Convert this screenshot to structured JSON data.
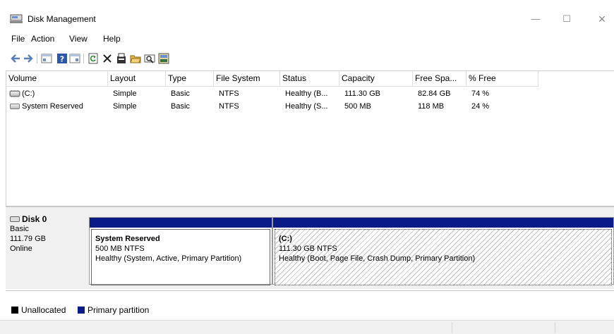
{
  "window": {
    "title": "Disk Management",
    "minimize": "—",
    "maximize": "☐",
    "close": "✕"
  },
  "menu": [
    "File",
    "Action",
    "View",
    "Help"
  ],
  "columns": [
    "Volume",
    "Layout",
    "Type",
    "File System",
    "Status",
    "Capacity",
    "Free Spa...",
    "% Free"
  ],
  "volumes": [
    {
      "volume": "(C:)",
      "layout": "Simple",
      "type": "Basic",
      "fs": "NTFS",
      "status": "Healthy (B...",
      "capacity": "111.30 GB",
      "free": "82.84 GB",
      "pct": "74 %"
    },
    {
      "volume": "System Reserved",
      "layout": "Simple",
      "type": "Basic",
      "fs": "NTFS",
      "status": "Healthy (S...",
      "capacity": "500 MB",
      "free": "118 MB",
      "pct": "24 %"
    }
  ],
  "disk": {
    "name": "Disk 0",
    "type": "Basic",
    "size": "111.79 GB",
    "state": "Online",
    "partitions": [
      {
        "name": "System Reserved",
        "size": "500 MB NTFS",
        "status": "Healthy (System, Active, Primary Partition)"
      },
      {
        "name": "(C:)",
        "size": "111.30 GB NTFS",
        "status": "Healthy (Boot, Page File, Crash Dump, Primary Partition)"
      }
    ]
  },
  "legend": [
    {
      "label": "Unallocated",
      "color": "#000000"
    },
    {
      "label": "Primary partition",
      "color": "#0a1a86"
    }
  ],
  "colors": {
    "primary_partition": "#0a1a86",
    "unallocated": "#000000"
  }
}
